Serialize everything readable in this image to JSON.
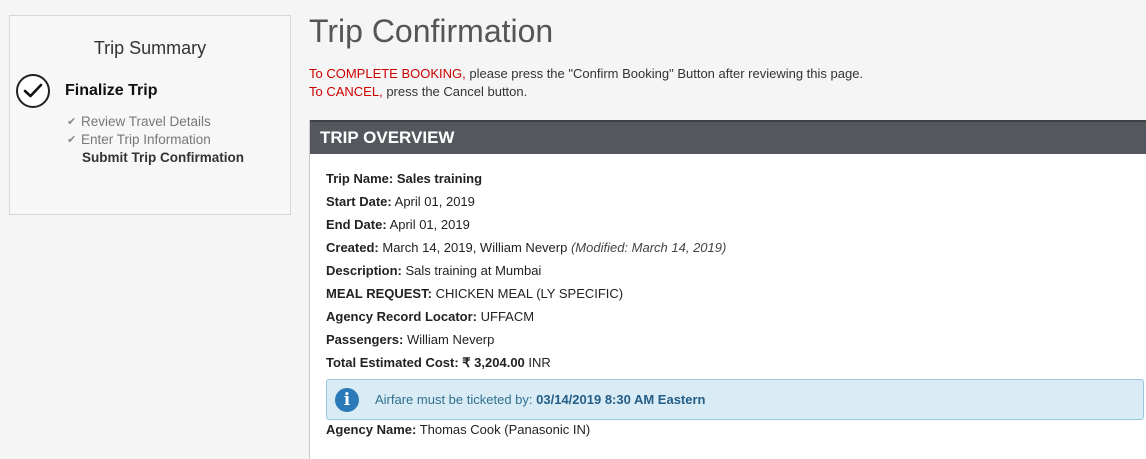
{
  "sidebar": {
    "title": "Trip Summary",
    "step_title": "Finalize Trip",
    "substeps": [
      {
        "label": "Review Travel Details",
        "done": true
      },
      {
        "label": "Enter Trip Information",
        "done": true
      },
      {
        "label": "Submit Trip Confirmation",
        "done": false
      }
    ]
  },
  "page": {
    "title": "Trip Confirmation",
    "instruction1_red": "To COMPLETE BOOKING,",
    "instruction1_rest": " please press the \"Confirm Booking\" Button after reviewing this page.",
    "instruction2_red": "To CANCEL,",
    "instruction2_rest": " press the Cancel button."
  },
  "overview": {
    "header": "TRIP OVERVIEW",
    "trip_name_label": "Trip Name:",
    "trip_name": "Sales training",
    "start_date_label": "Start Date:",
    "start_date": "April 01, 2019",
    "end_date_label": "End Date:",
    "end_date": "April 01, 2019",
    "created_label": "Created:",
    "created": "March 14, 2019, William Neverp",
    "modified": "(Modified: March 14, 2019)",
    "description_label": "Description:",
    "description": "Sals training at Mumbai",
    "meal_label": "MEAL REQUEST:",
    "meal": "CHICKEN MEAL (LY SPECIFIC)",
    "locator_label": "Agency Record Locator:",
    "locator": "UFFACM",
    "passengers_label": "Passengers:",
    "passengers": "William Neverp",
    "cost_label": "Total Estimated Cost:",
    "cost_amount": "₹ 3,204.00",
    "cost_currency": "INR",
    "alert_text": "Airfare must be ticketed by:",
    "alert_deadline": "03/14/2019 8:30 AM Eastern",
    "agency_label": "Agency Name:",
    "agency": "Thomas Cook (Panasonic IN)"
  }
}
